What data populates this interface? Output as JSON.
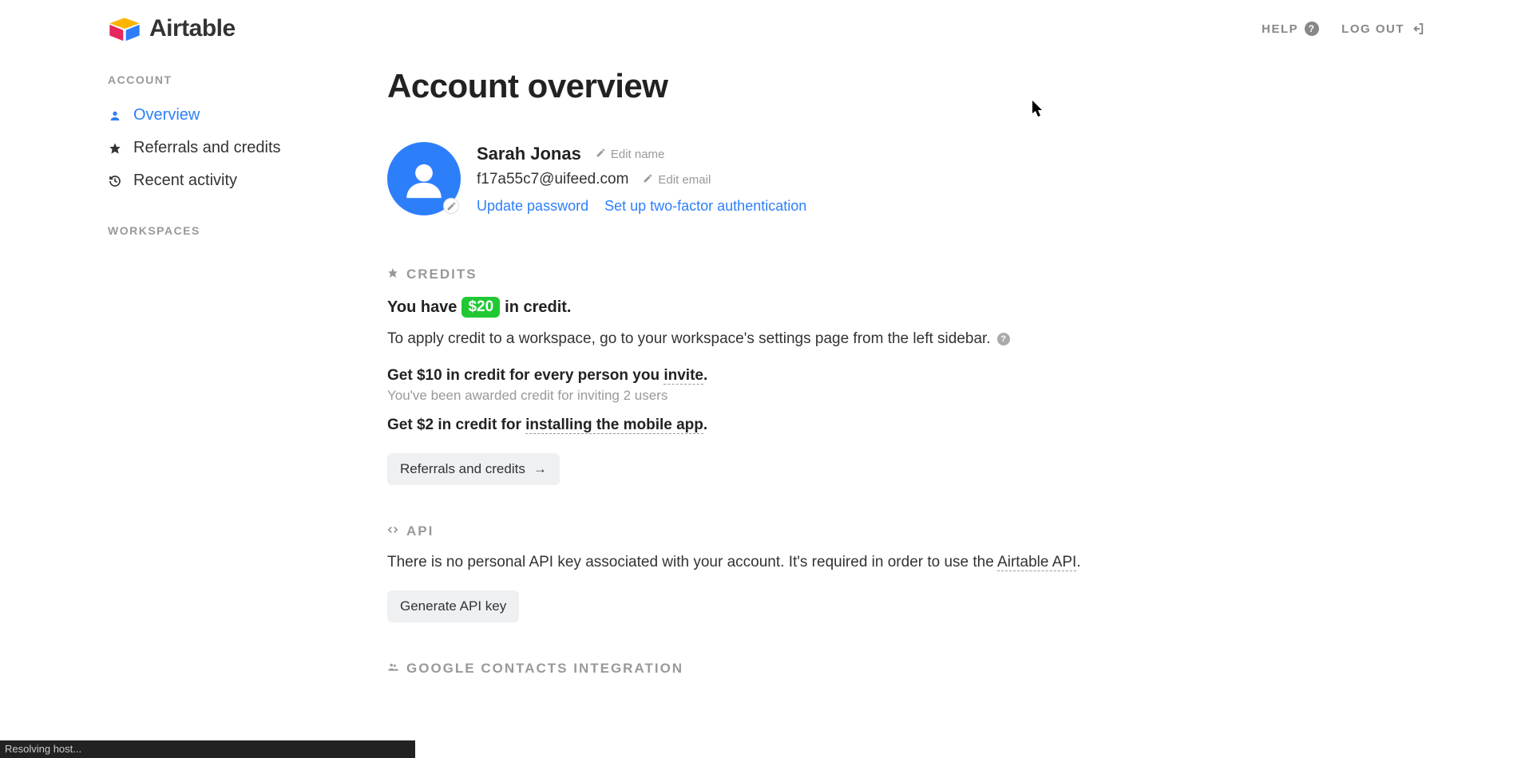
{
  "header": {
    "brand": "Airtable",
    "help": "HELP",
    "logout": "LOG OUT"
  },
  "sidebar": {
    "account_heading": "ACCOUNT",
    "items": [
      {
        "label": "Overview"
      },
      {
        "label": "Referrals and credits"
      },
      {
        "label": "Recent activity"
      }
    ],
    "workspaces_heading": "WORKSPACES"
  },
  "main": {
    "title": "Account overview",
    "profile": {
      "name": "Sarah Jonas",
      "edit_name": "Edit name",
      "email": "f17a55c7@uifeed.com",
      "edit_email": "Edit email",
      "update_password": "Update password",
      "setup_2fa": "Set up two-factor authentication"
    },
    "credits": {
      "heading": "CREDITS",
      "have_pre": "You have",
      "amount": "$20",
      "have_post": "in credit.",
      "apply_text": "To apply credit to a workspace, go to your workspace's settings page from the left sidebar.",
      "invite_pre": "Get $10 in credit for every person you ",
      "invite_link": "invite",
      "invite_post": ".",
      "invite_sub": "You've been awarded credit for inviting 2 users",
      "mobile_pre": "Get $2 in credit for ",
      "mobile_link": "installing the mobile app",
      "mobile_post": ".",
      "referrals_btn": "Referrals and credits"
    },
    "api": {
      "heading": "API",
      "text_pre": "There is no personal API key associated with your account. It's required in order to use the ",
      "text_link": "Airtable API",
      "text_post": ".",
      "generate_btn": "Generate API key"
    },
    "gcontacts": {
      "heading": "GOOGLE CONTACTS INTEGRATION"
    }
  },
  "status": "Resolving host..."
}
